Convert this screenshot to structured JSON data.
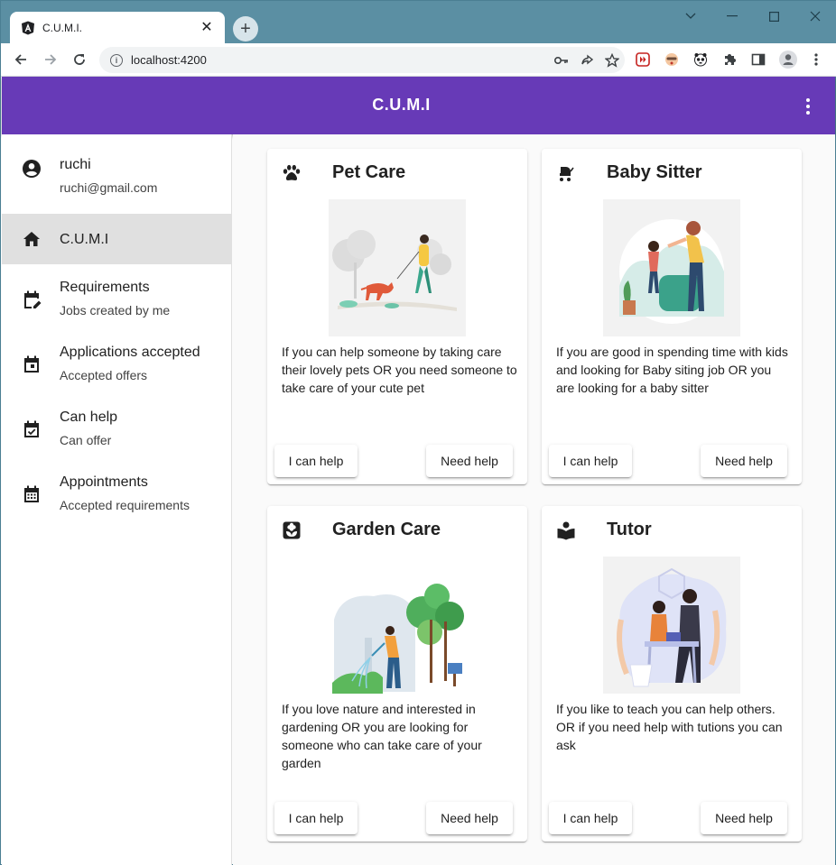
{
  "browser": {
    "tab_title": "C.U.M.I.",
    "url": "localhost:4200"
  },
  "app": {
    "title": "C.U.M.I",
    "accent": "#673ab7"
  },
  "sidebar": {
    "user": {
      "name": "ruchi",
      "email": "ruchi@gmail.com"
    },
    "items": [
      {
        "label": "C.U.M.I",
        "icon": "home-icon",
        "active": true
      },
      {
        "label": "Requirements",
        "sub": "Jobs created by me",
        "icon": "edit-calendar-icon"
      },
      {
        "label": "Applications accepted",
        "sub": "Accepted offers",
        "icon": "event-icon"
      },
      {
        "label": "Can help",
        "sub": "Can offer",
        "icon": "event-available-icon"
      },
      {
        "label": "Appointments",
        "sub": "Accepted requirements",
        "icon": "calendar-month-icon"
      }
    ]
  },
  "cards": [
    {
      "title": "Pet Care",
      "icon": "paw-icon",
      "text": "If you can help someone by taking care their lovely pets OR you need someone to take care of your cute pet",
      "btn_help": "I can help",
      "btn_need": "Need help"
    },
    {
      "title": "Baby Sitter",
      "icon": "stroller-icon",
      "text": "If you are good in spending time with kids and looking for Baby siting job OR you are looking for a baby sitter",
      "btn_help": "I can help",
      "btn_need": "Need help"
    },
    {
      "title": "Garden Care",
      "icon": "local-florist-icon",
      "text": "If you love nature and interested in gardening OR you are looking for someone who can take care of your garden",
      "btn_help": "I can help",
      "btn_need": "Need help"
    },
    {
      "title": "Tutor",
      "icon": "local-library-icon",
      "text": "If you like to teach you can help others. OR if you need help with tutions you can ask",
      "btn_help": "I can help",
      "btn_need": "Need help"
    }
  ]
}
